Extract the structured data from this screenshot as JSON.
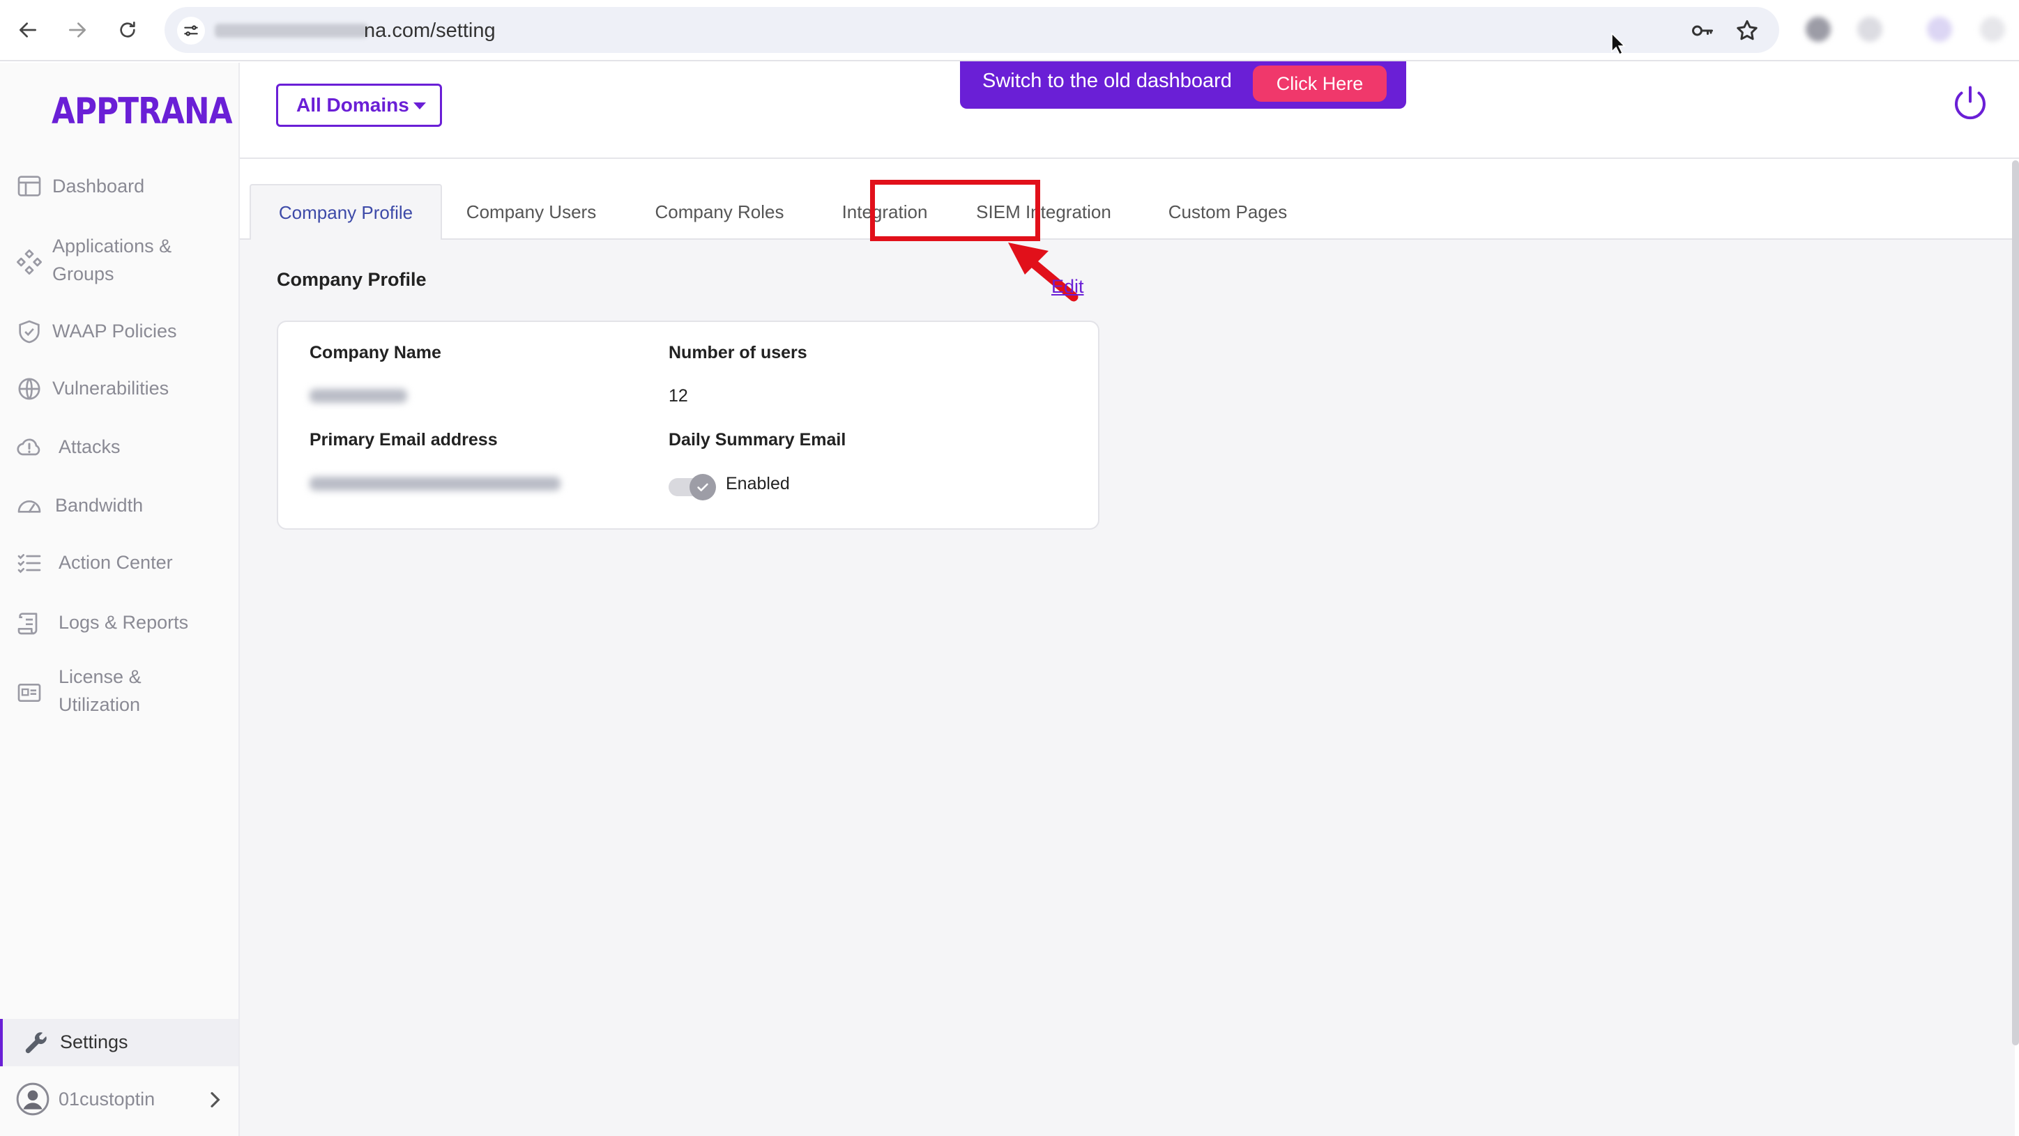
{
  "browser": {
    "url": "na.com/setting"
  },
  "sidebar": {
    "logo": "APPTRANA",
    "items": [
      {
        "label": "Dashboard",
        "icon": "dashboard-icon"
      },
      {
        "label": "Applications & Groups",
        "line1": "Applications &",
        "line2": "Groups",
        "icon": "applications-icon"
      },
      {
        "label": "WAAP Policies",
        "icon": "shield-icon"
      },
      {
        "label": "Vulnerabilities",
        "icon": "globe-icon"
      },
      {
        "label": "Attacks",
        "icon": "alert-cloud-icon"
      },
      {
        "label": "Bandwidth",
        "icon": "gauge-icon"
      },
      {
        "label": "Action Center",
        "icon": "checklist-icon"
      },
      {
        "label": "Logs & Reports",
        "icon": "scroll-icon"
      },
      {
        "label": "License & Utilization",
        "line1": "License &",
        "line2": "Utilization",
        "icon": "license-icon"
      }
    ],
    "settings_label": "Settings",
    "user_label": "01custoptin"
  },
  "topbar": {
    "domains_label": "All Domains",
    "switch_text": "Switch to the old dashboard",
    "click_here": "Click Here"
  },
  "tabs": [
    {
      "label": "Company Profile",
      "active": true
    },
    {
      "label": "Company Users",
      "active": false
    },
    {
      "label": "Company Roles",
      "active": false
    },
    {
      "label": "Integration",
      "active": false
    },
    {
      "label": "SIEM Integration",
      "active": false
    },
    {
      "label": "Custom Pages",
      "active": false
    }
  ],
  "profile": {
    "title": "Company Profile",
    "edit_label": "Edit",
    "company_name_label": "Company Name",
    "number_of_users_label": "Number of users",
    "number_of_users_value": "12",
    "primary_email_label": "Primary Email address",
    "daily_summary_label": "Daily Summary Email",
    "daily_summary_value": "Enabled"
  },
  "colors": {
    "brand": "#6a1fd6",
    "cta": "#f0386b",
    "highlight": "#e1101a"
  }
}
